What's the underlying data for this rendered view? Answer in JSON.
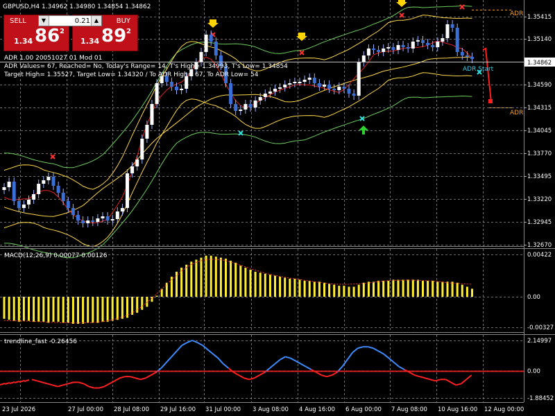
{
  "chart_header": "GBPUSD,H4  1.34962 1.34980 1.34854 1.34862",
  "trade_panel": {
    "sell_label": "SELL",
    "buy_label": "BUY",
    "volume": "0.21",
    "sell_price_prefix": "1.34",
    "sell_price_big": "86",
    "sell_price_sup": "2",
    "buy_price_prefix": "1.34",
    "buy_price_big": "89",
    "buy_price_sup": "2"
  },
  "info_lines": [
    "ADR 1.00 20051027 01 Mod 01",
    "ADR Values= 67, Reached= No, Today's Range= 14, T's High= 1.34993, T's Low= 1.34854",
    "Target High= 1.35527, Target Low= 1.34320 / To ADR High= 67, To ADR Low= 54"
  ],
  "chart_labels": {
    "adr_top": "ADR",
    "adr_bottom": "ADR",
    "adr_start": "ADR Start"
  },
  "price_axis": [
    "1.35415",
    "1.35140",
    "1.34862",
    "1.34590",
    "1.34315",
    "1.34045",
    "1.33770",
    "1.33495",
    "1.33220",
    "1.32945",
    "1.32670"
  ],
  "current_price": "1.34862",
  "macd": {
    "label": "MACD(12,26,9) 0.00077 0.00126",
    "axis": [
      "0.00422",
      "0.00",
      "-0.00327"
    ]
  },
  "trendline": {
    "label": "trendline_fast -0.26456",
    "axis": [
      "2.14997",
      "0.00",
      "-1.88452"
    ]
  },
  "time_axis": [
    "23 Jul 2026",
    "27 Jul 00:00",
    "28 Jul 08:00",
    "29 Jul 16:00",
    "31 Jul 00:00",
    "3 Aug 08:00",
    "4 Aug 16:00",
    "6 Aug 00:00",
    "7 Aug 08:00",
    "10 Aug 16:00",
    "12 Aug 00:00"
  ],
  "colors": {
    "background": "#000000",
    "grid": "#c8c8c8",
    "bull_candle": "#ffffff",
    "bear_candle": "#3a6fd8",
    "macd_bars": "#ffee33",
    "macd_signal": "#ff3030",
    "trend_up": "#3f8cff",
    "trend_down": "#ff2020",
    "bollinger": "#ffd84a",
    "envelope": "#6fcf5f",
    "moving_average": "#e02020",
    "panel_red": "#c0101a",
    "adr_label": "#f0a030"
  }
}
